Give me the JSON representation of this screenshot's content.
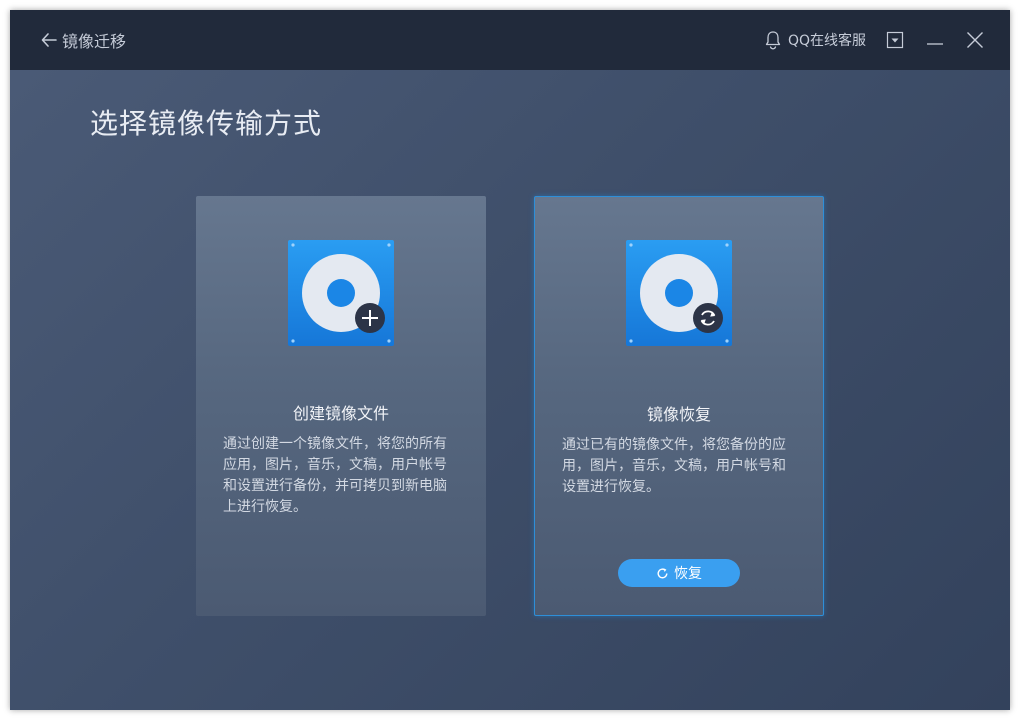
{
  "header": {
    "back_label": "镜像迁移",
    "qq_service_label": "QQ在线客服"
  },
  "main": {
    "title": "选择镜像传输方式",
    "cards": [
      {
        "title": "创建镜像文件",
        "description": "通过创建一个镜像文件，将您的所有应用，图片，音乐，文稿，用户帐号和设置进行备份，并可拷贝到新电脑上进行恢复。",
        "icon": "disk-add-icon"
      },
      {
        "title": "镜像恢复",
        "description": "通过已有的镜像文件，将您备份的应用，图片，音乐，文稿，用户帐号和设置进行恢复。",
        "icon": "disk-restore-icon",
        "button_label": "恢复"
      }
    ]
  },
  "colors": {
    "titlebar": "#212a3b",
    "accent": "#3a9ff0",
    "selected_border": "#2e8fd8"
  }
}
